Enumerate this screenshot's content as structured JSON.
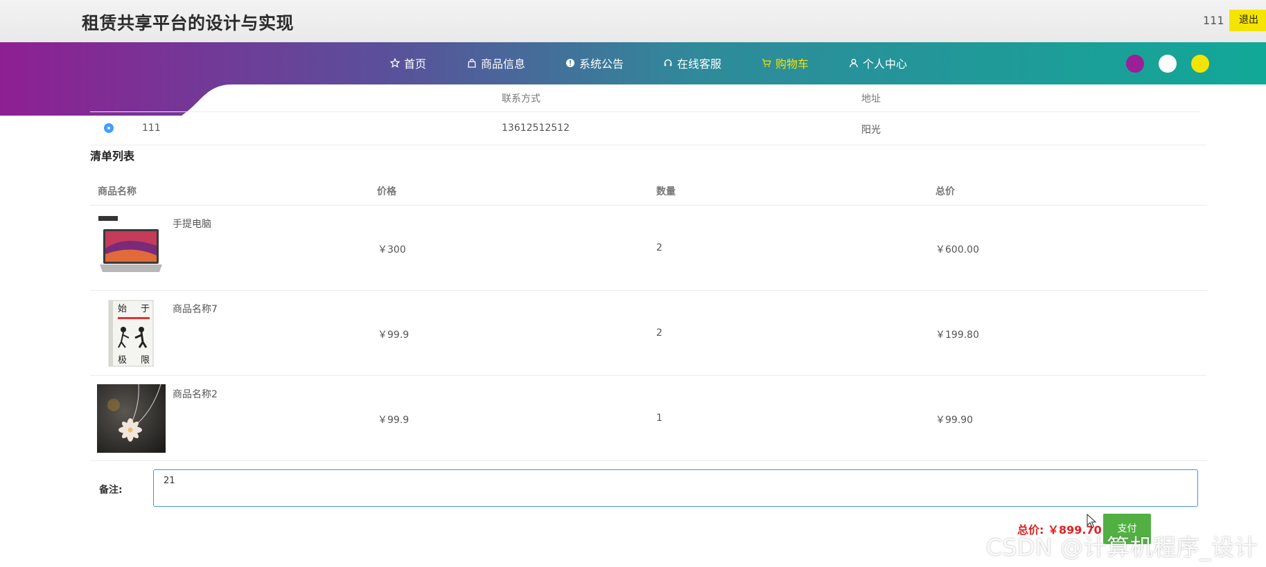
{
  "header": {
    "title": "租赁共享平台的设计与实现",
    "username": "111",
    "logout_label": "退出"
  },
  "nav": {
    "items": [
      {
        "label": "首页",
        "icon": "star-icon"
      },
      {
        "label": "商品信息",
        "icon": "bag-icon"
      },
      {
        "label": "系统公告",
        "icon": "info-icon"
      },
      {
        "label": "在线客服",
        "icon": "headset-icon"
      },
      {
        "label": "购物车",
        "icon": "cart-icon",
        "active": true
      },
      {
        "label": "个人中心",
        "icon": "user-icon"
      }
    ],
    "active_color": "#f5e400"
  },
  "themes": [
    "#9b1f97",
    "#ffffff",
    "#f5e400"
  ],
  "address": {
    "columns": {
      "contact": "联系方式",
      "address": "地址"
    },
    "row": {
      "name": "111",
      "phone": "13612512512",
      "address": "阳光"
    }
  },
  "order": {
    "section_title": "清单列表",
    "columns": {
      "name": "商品名称",
      "price": "价格",
      "qty": "数量",
      "total": "总价"
    },
    "items": [
      {
        "name": "手提电脑",
        "price": "￥300",
        "qty": "2",
        "total": "￥600.00",
        "image": "laptop"
      },
      {
        "name": "商品名称7",
        "price": "￥99.9",
        "qty": "2",
        "total": "￥199.80",
        "image": "book"
      },
      {
        "name": "商品名称2",
        "price": "￥99.9",
        "qty": "1",
        "total": "￥99.90",
        "image": "necklace"
      }
    ]
  },
  "remark": {
    "label": "备注:",
    "value": "21"
  },
  "summary": {
    "total_label": "总价: ￥899.70",
    "pay_label": "支付"
  },
  "watermark": "CSDN @计算机程序_设计",
  "colors": {
    "nav_start": "#8e1f93",
    "nav_end": "#12a898",
    "pay": "#52b043",
    "total": "#e02020"
  }
}
